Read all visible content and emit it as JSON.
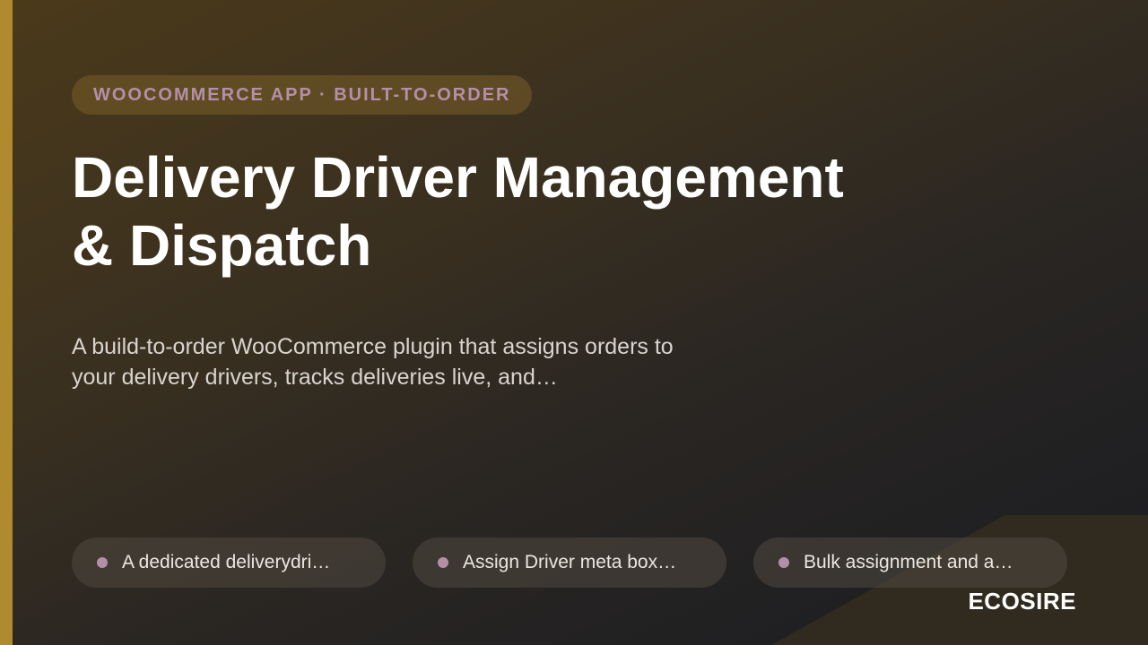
{
  "eyebrow": "WOOCOMMERCE APP · BUILT-TO-ORDER",
  "title": {
    "line1": "Delivery Driver Management",
    "line2": "& Dispatch"
  },
  "description": {
    "line1": "A build-to-order WooCommerce plugin that assigns orders to",
    "line2": "your delivery drivers, tracks deliveries live, and…"
  },
  "features": [
    {
      "label": "A dedicated deliverydri…"
    },
    {
      "label": "Assign Driver meta box…"
    },
    {
      "label": "Bulk assignment and a…"
    }
  ],
  "brand": "ECOSIRE",
  "colors": {
    "accent": "#b08a2e",
    "eyebrow_text": "#b48fa8",
    "bullet": "#b48fa8"
  }
}
